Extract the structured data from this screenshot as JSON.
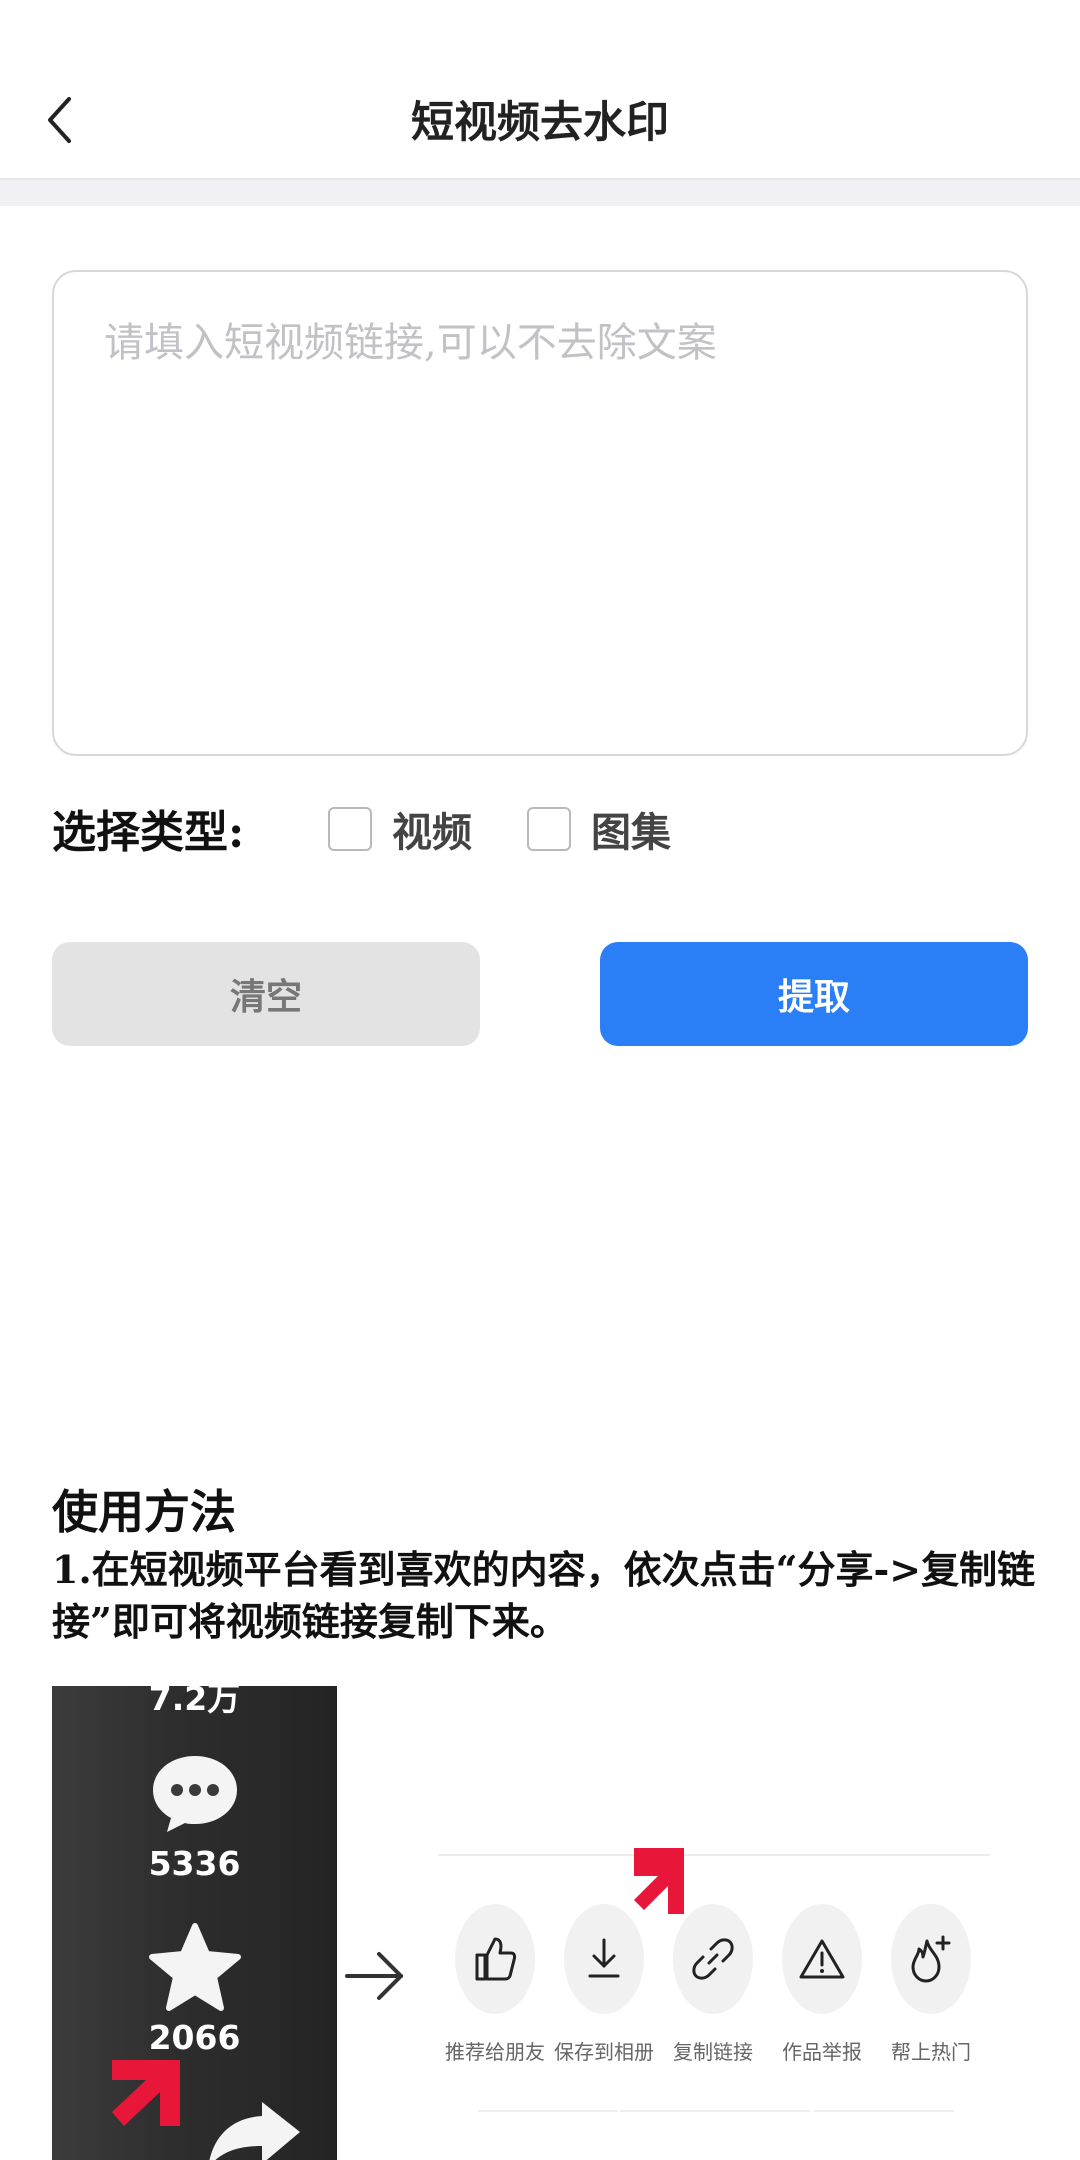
{
  "header": {
    "title": "短视频去水印"
  },
  "form": {
    "link_placeholder": "请填入短视频链接,可以不去除文案",
    "link_value": "",
    "type_label": "选择类型:",
    "options": [
      {
        "label": "视频",
        "checked": false
      },
      {
        "label": "图集",
        "checked": false
      }
    ],
    "clear_label": "清空",
    "extract_label": "提取"
  },
  "usage": {
    "title": "使用方法",
    "step1": "1.在短视频平台看到喜欢的内容，依次点击“分享->复制链接”即可将视频链接复制下来。"
  },
  "illustration": {
    "left_panel": {
      "top_count": "7.2万",
      "comment_count": "5336",
      "favorite_count": "2066"
    },
    "share_actions": [
      {
        "icon": "thumbs-up-icon",
        "label": "推荐给朋友"
      },
      {
        "icon": "download-icon",
        "label": "保存到相册"
      },
      {
        "icon": "link-icon",
        "label": "复制链接"
      },
      {
        "icon": "warning-icon",
        "label": "作品举报"
      },
      {
        "icon": "flame-plus-icon",
        "label": "帮上热门"
      }
    ],
    "colors": {
      "highlight_arrow": "#e8173a",
      "primary_button": "#2a7ef6"
    }
  }
}
